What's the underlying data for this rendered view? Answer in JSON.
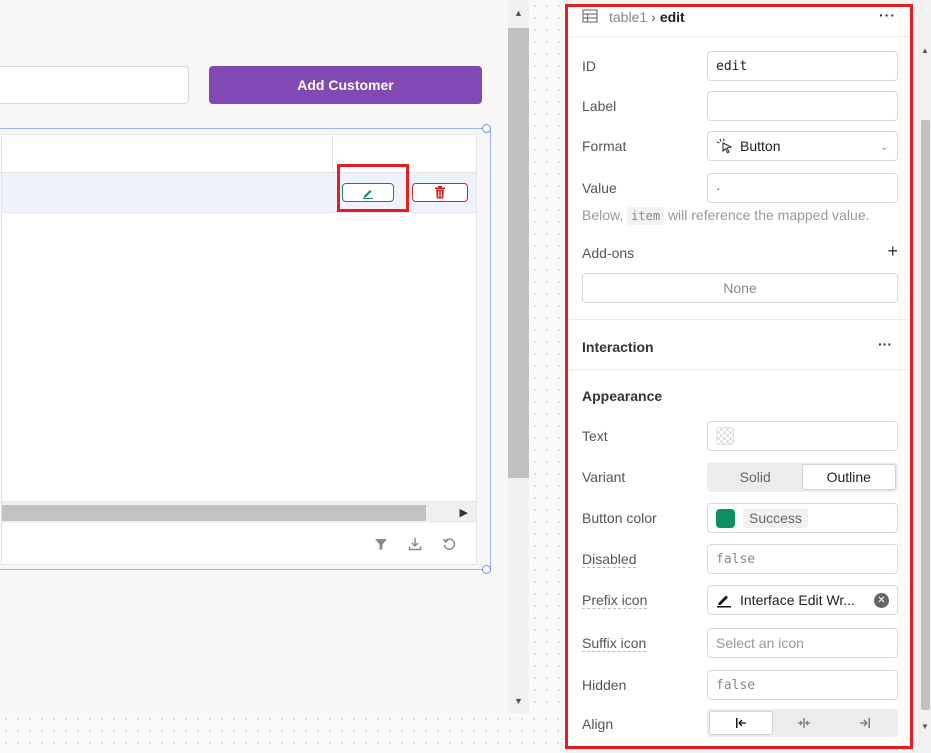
{
  "canvas": {
    "add_customer_label": "Add Customer"
  },
  "inspector": {
    "breadcrumb_parent": "table1",
    "breadcrumb_current": "edit",
    "more_label": "···",
    "fields": {
      "id_label": "ID",
      "id_value": "edit",
      "label_label": "Label",
      "label_value": "",
      "format_label": "Format",
      "format_value": "Button",
      "value_label": "Value",
      "value_value": "·",
      "hint_before": "Below,",
      "hint_code": "item",
      "hint_after": "will reference the mapped value."
    },
    "addons": {
      "label": "Add-ons",
      "add_symbol": "+",
      "none_label": "None"
    },
    "interaction": {
      "title": "Interaction",
      "more_label": "···"
    },
    "appearance": {
      "title": "Appearance",
      "text_label": "Text",
      "variant_label": "Variant",
      "variant_options": [
        "Solid",
        "Outline"
      ],
      "variant_selected": "Outline",
      "button_color_label": "Button color",
      "button_color_value": "Success",
      "button_color_hex": "#0b8f63",
      "disabled_label": "Disabled",
      "disabled_value": "false",
      "prefix_icon_label": "Prefix icon",
      "prefix_icon_value": "Interface Edit Wr...",
      "suffix_icon_label": "Suffix icon",
      "suffix_icon_placeholder": "Select an icon",
      "hidden_label": "Hidden",
      "hidden_value": "false",
      "align_label": "Align"
    }
  },
  "colors": {
    "primary_button": "#8248b4",
    "success": "#0f8a5f",
    "danger": "#d0241e",
    "highlight": "#e1201f"
  }
}
